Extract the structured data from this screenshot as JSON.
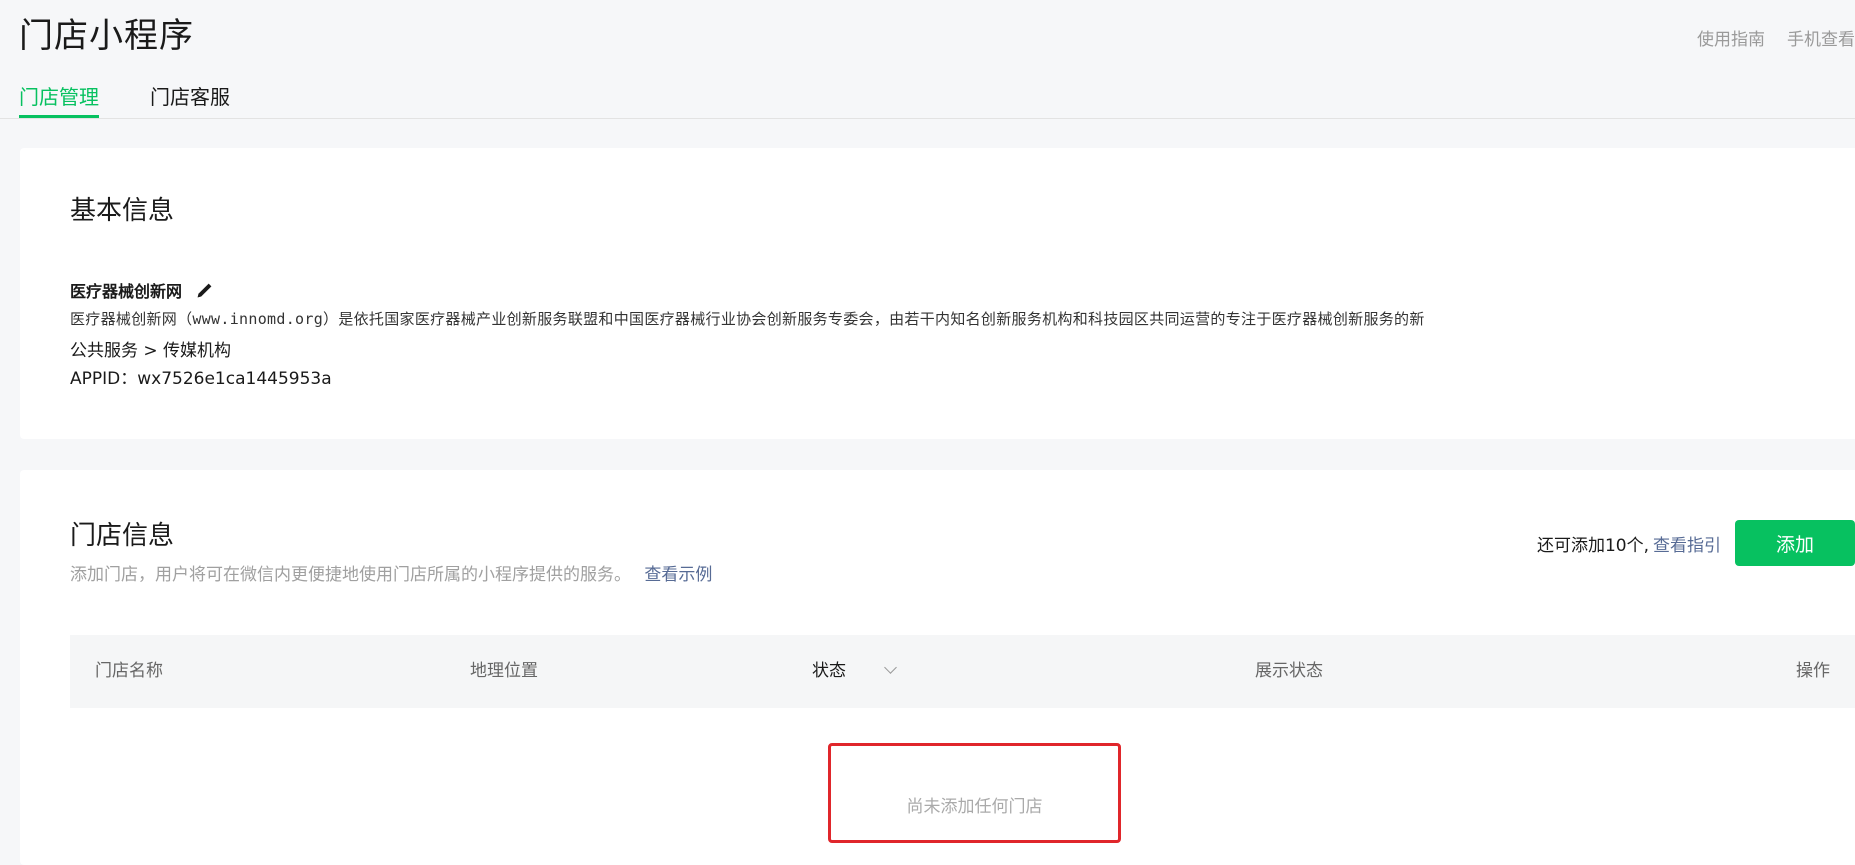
{
  "header": {
    "title": "门店小程序",
    "links": [
      "使用指南",
      "手机查看"
    ]
  },
  "tabs": [
    {
      "label": "门店管理",
      "active": true
    },
    {
      "label": "门店客服",
      "active": false
    }
  ],
  "basic_info": {
    "title": "基本信息",
    "name": "医疗器械创新网",
    "description": "医疗器械创新网（www.innomd.org）是依托国家医疗器械产业创新服务联盟和中国医疗器械行业协会创新服务专委会，由若干内知名创新服务机构和科技园区共同运营的专注于医疗器械创新服务的新",
    "category": "公共服务 > 传媒机构",
    "appid": "APPID：wx7526e1ca1445953a",
    "icons": {
      "edit": "pencil-icon"
    }
  },
  "store_info": {
    "title": "门店信息",
    "hint": "添加门店，用户将可在微信内更便捷地使用门店所属的小程序提供的服务。",
    "example_link": "查看示例",
    "remaining": "还可添加10个,",
    "guide_link": "查看指引",
    "add_button": "添加",
    "columns": [
      "门店名称",
      "地理位置",
      "状态",
      "展示状态",
      "操作"
    ],
    "empty_text": "尚未添加任何门店"
  },
  "colors": {
    "accent": "#07c160",
    "link": "#576b95",
    "highlight": "#e0262b"
  }
}
